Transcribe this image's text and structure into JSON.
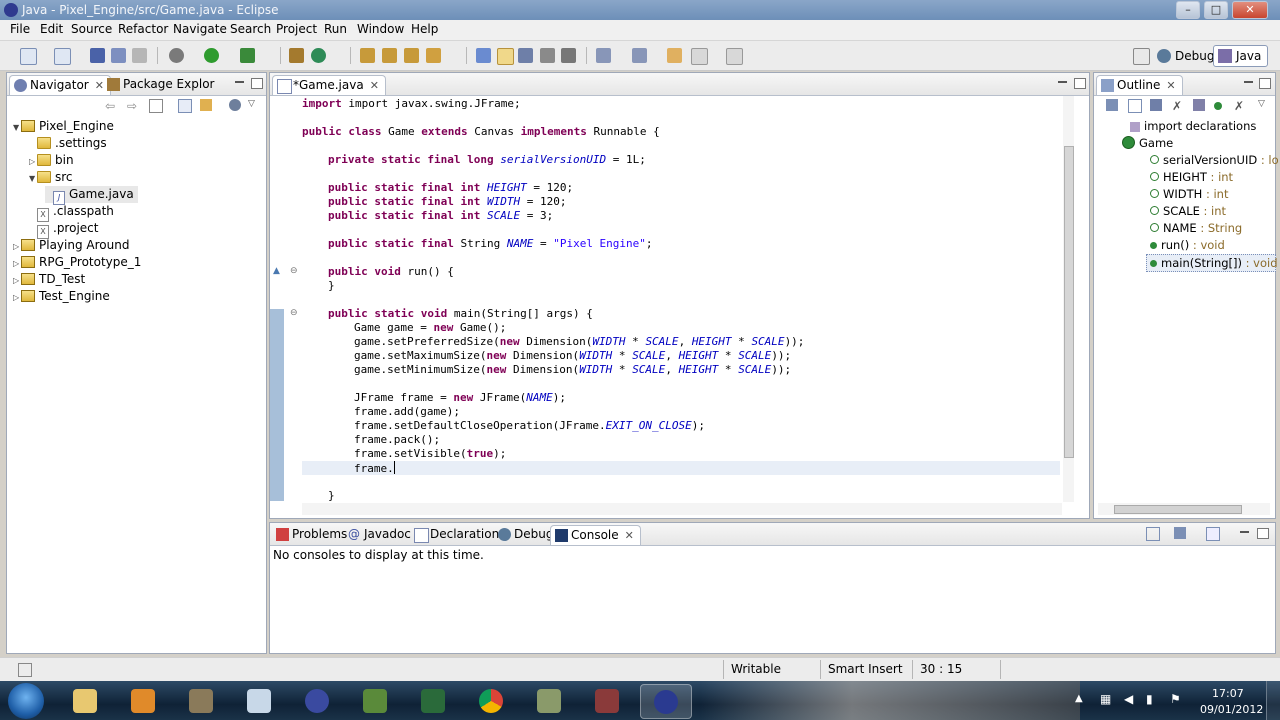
{
  "window": {
    "title": "Java - Pixel_Engine/src/Game.java - Eclipse"
  },
  "menu": [
    "File",
    "Edit",
    "Source",
    "Refactor",
    "Navigate",
    "Search",
    "Project",
    "Run",
    "Window",
    "Help"
  ],
  "perspectives": {
    "debug": "Debug",
    "java": "Java"
  },
  "navigator": {
    "tabs": {
      "navigator": "Navigator",
      "package_explorer": "Package Explor"
    },
    "tree": {
      "pixel_engine": "Pixel_Engine",
      "settings": ".settings",
      "bin": "bin",
      "src": "src",
      "game_java": "Game.java",
      "classpath": ".classpath",
      "project": ".project",
      "playing_around": "Playing Around",
      "rpg": "RPG_Prototype_1",
      "td": "TD_Test",
      "test_engine": "Test_Engine"
    }
  },
  "editor": {
    "tab": "*Game.java",
    "code": {
      "l1": "import javax.swing.JFrame;",
      "l2a": "public",
      "l2b": "class",
      "l2c": "Game",
      "l2d": "extends",
      "l2e": "Canvas",
      "l2f": "implements",
      "l2g": "Runnable {",
      "l3a": "private static final long",
      "l3b": "serialVersionUID",
      "l3c": " = 1L;",
      "l4a": "public static final int",
      "l4b": "HEIGHT",
      "l4c": " = 120;",
      "l5a": "public static final int",
      "l5b": "WIDTH",
      "l5c": " = 120;",
      "l6a": "public static final int",
      "l6b": "SCALE",
      "l6c": " = 3;",
      "l7a": "public static final",
      "l7b": " String ",
      "l7c": "NAME",
      "l7d": " = ",
      "l7e": "\"Pixel Engine\"",
      "l7f": ";",
      "l8a": "public void",
      "l8b": " run() {",
      "l9": "}",
      "l10a": "public static void",
      "l10b": " main(String[] args) {",
      "l11a": "Game game = ",
      "l11b": "new",
      "l11c": " Game();",
      "l12a": "game.setPreferredSize(",
      "l12b": "new",
      "l12c": " Dimension(",
      "l12d": "WIDTH",
      "l12e": " * ",
      "l12f": "SCALE",
      "l12g": ", ",
      "l12h": "HEIGHT",
      "l12i": " * ",
      "l12j": "SCALE",
      "l12k": "));",
      "l13a": "game.setMaximumSize(",
      "l13b": "new",
      "l13c": " Dimension(",
      "l13d": "WIDTH",
      "l13e": " * ",
      "l13f": "SCALE",
      "l13g": ", ",
      "l13h": "HEIGHT",
      "l13i": " * ",
      "l13j": "SCALE",
      "l13k": "));",
      "l14a": "game.setMinimumSize(",
      "l14b": "new",
      "l14c": " Dimension(",
      "l14d": "WIDTH",
      "l14e": " * ",
      "l14f": "SCALE",
      "l14g": ", ",
      "l14h": "HEIGHT",
      "l14i": " * ",
      "l14j": "SCALE",
      "l14k": "));",
      "l15a": "JFrame frame = ",
      "l15b": "new",
      "l15c": " JFrame(",
      "l15d": "NAME",
      "l15e": ");",
      "l16": "frame.add(game);",
      "l17a": "frame.setDefaultCloseOperation(JFrame.",
      "l17b": "EXIT_ON_CLOSE",
      "l17c": ");",
      "l18": "frame.pack();",
      "l19a": "frame.setVisible(",
      "l19b": "true",
      "l19c": ");",
      "l20": "frame.",
      "l21": "}"
    }
  },
  "outline": {
    "tab": "Outline",
    "items": {
      "imports": "import declarations",
      "game": "Game",
      "f1n": "serialVersionUID",
      "f1t": " : lo",
      "f2n": "HEIGHT",
      "f2t": " : int",
      "f3n": "WIDTH",
      "f3t": " : int",
      "f4n": "SCALE",
      "f4t": " : int",
      "f5n": "NAME",
      "f5t": " : String",
      "m1n": "run()",
      "m1t": " : void",
      "m2n": "main(String[])",
      "m2t": " : void"
    }
  },
  "bottom": {
    "tabs": {
      "problems": "Problems",
      "javadoc": "Javadoc",
      "declaration": "Declaration",
      "debug": "Debug",
      "console": "Console"
    },
    "console_message": "No consoles to display at this time."
  },
  "status": {
    "writable": "Writable",
    "insert_mode": "Smart Insert",
    "position": "30 : 15"
  },
  "taskbar": {
    "time": "17:07",
    "date": "09/01/2012"
  }
}
